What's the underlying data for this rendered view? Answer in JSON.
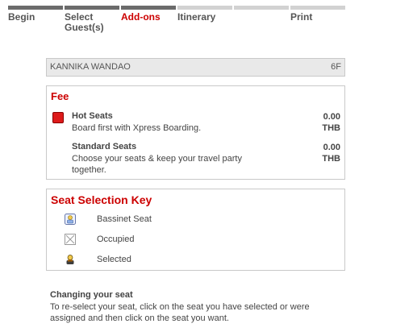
{
  "steps": [
    {
      "label": "Begin",
      "state": "done"
    },
    {
      "label": "Select Guest(s)",
      "state": "done"
    },
    {
      "label": "Add-ons",
      "state": "active"
    },
    {
      "label": "Itinerary",
      "state": "pending"
    },
    {
      "label": "",
      "state": "pending"
    },
    {
      "label": "Print",
      "state": "pending"
    }
  ],
  "passenger": {
    "name": "KANNIKA WANDAO",
    "seat": "6F"
  },
  "fee": {
    "title": "Fee",
    "items": [
      {
        "name": "Hot Seats",
        "description": "Board first with Xpress Boarding.",
        "amount": "0.00",
        "currency": "THB",
        "icon": "hot-seat-icon",
        "icon_color": "#dd1a1a"
      },
      {
        "name": "Standard Seats",
        "description": "Choose your seats & keep your travel party together.",
        "amount": "0.00",
        "currency": "THB"
      }
    ]
  },
  "key": {
    "title": "Seat Selection Key",
    "items": [
      {
        "label": "Bassinet Seat",
        "icon": "bassinet-seat-icon"
      },
      {
        "label": "Occupied",
        "icon": "occupied-seat-icon"
      },
      {
        "label": "Selected",
        "icon": "selected-seat-icon"
      }
    ]
  },
  "info": {
    "title": "Changing your seat",
    "body": "To re-select your seat, click on the seat you have selected or were assigned and then click on the seat you want."
  },
  "colors": {
    "accent": "#cc0000",
    "step_done": "#6b6b6b",
    "step_pending": "#d2d2d2"
  }
}
